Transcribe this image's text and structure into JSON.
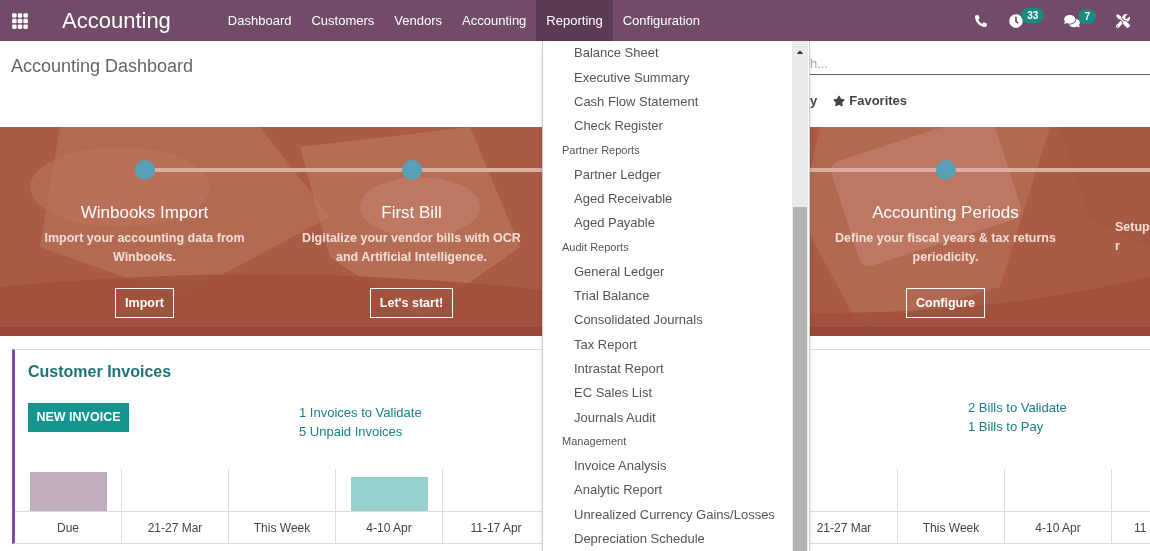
{
  "navbar": {
    "app_name": "Accounting",
    "menu": [
      {
        "label": "Dashboard",
        "selected": false
      },
      {
        "label": "Customers",
        "selected": false
      },
      {
        "label": "Vendors",
        "selected": false
      },
      {
        "label": "Accounting",
        "selected": false
      },
      {
        "label": "Reporting",
        "selected": true
      },
      {
        "label": "Configuration",
        "selected": false
      }
    ],
    "activity_count": "33",
    "message_count": "7"
  },
  "control_panel": {
    "title": "Accounting Dashboard",
    "search": {
      "placeholder": "h..."
    },
    "filter_fragment": "y",
    "favorites": "Favorites"
  },
  "onboarding": {
    "steps": [
      {
        "title": "Winbooks Import",
        "description": [
          "Import your accounting data from",
          "Winbooks."
        ],
        "button": "Import"
      },
      {
        "title": "First Bill",
        "description": [
          "Digitalize your vendor bills with OCR",
          "and Artificial Intelligence."
        ],
        "button": "Let's start!"
      },
      {
        "title": "Accounting Periods",
        "description": [
          "Define your fiscal years & tax returns",
          "periodicity."
        ],
        "button": "Configure"
      },
      {
        "description": [
          "Setup",
          "r"
        ]
      }
    ]
  },
  "cards": [
    {
      "title": "Customer Invoices",
      "button": "NEW INVOICE",
      "links": [
        "1 Invoices to Validate",
        "5 Unpaid Invoices"
      ],
      "columns": [
        {
          "label": "Due",
          "kind": "past"
        },
        {
          "label": "21-27 Mar",
          "kind": "empty"
        },
        {
          "label": "This Week",
          "kind": "empty"
        },
        {
          "label": "4-10 Apr",
          "kind": "future"
        },
        {
          "label": "11-17 Apr",
          "kind": "empty"
        }
      ]
    },
    {
      "links": [
        "2 Bills to Validate",
        "1 Bills to Pay"
      ],
      "columns": [
        {
          "label": "21-27 Mar",
          "kind": "empty"
        },
        {
          "label": "This Week",
          "kind": "empty"
        },
        {
          "label": "4-10 Apr",
          "kind": "empty"
        },
        {
          "label": "11",
          "kind": "empty"
        }
      ]
    }
  ],
  "reporting_menu": [
    {
      "label": "Balance Sheet",
      "kind": "item"
    },
    {
      "label": "Executive Summary",
      "kind": "item"
    },
    {
      "label": "Cash Flow Statement",
      "kind": "item"
    },
    {
      "label": "Check Register",
      "kind": "item"
    },
    {
      "label": "Partner Reports",
      "kind": "header"
    },
    {
      "label": "Partner Ledger",
      "kind": "item"
    },
    {
      "label": "Aged Receivable",
      "kind": "item"
    },
    {
      "label": "Aged Payable",
      "kind": "item"
    },
    {
      "label": "Audit Reports",
      "kind": "header"
    },
    {
      "label": "General Ledger",
      "kind": "item"
    },
    {
      "label": "Trial Balance",
      "kind": "item"
    },
    {
      "label": "Consolidated Journals",
      "kind": "item"
    },
    {
      "label": "Tax Report",
      "kind": "item"
    },
    {
      "label": "Intrastat Report",
      "kind": "item"
    },
    {
      "label": "EC Sales List",
      "kind": "item"
    },
    {
      "label": "Journals Audit",
      "kind": "item"
    },
    {
      "label": "Management",
      "kind": "header"
    },
    {
      "label": "Invoice Analysis",
      "kind": "item"
    },
    {
      "label": "Analytic Report",
      "kind": "item"
    },
    {
      "label": "Unrealized Currency Gains/Losses",
      "kind": "item"
    },
    {
      "label": "Depreciation Schedule",
      "kind": "item"
    }
  ]
}
